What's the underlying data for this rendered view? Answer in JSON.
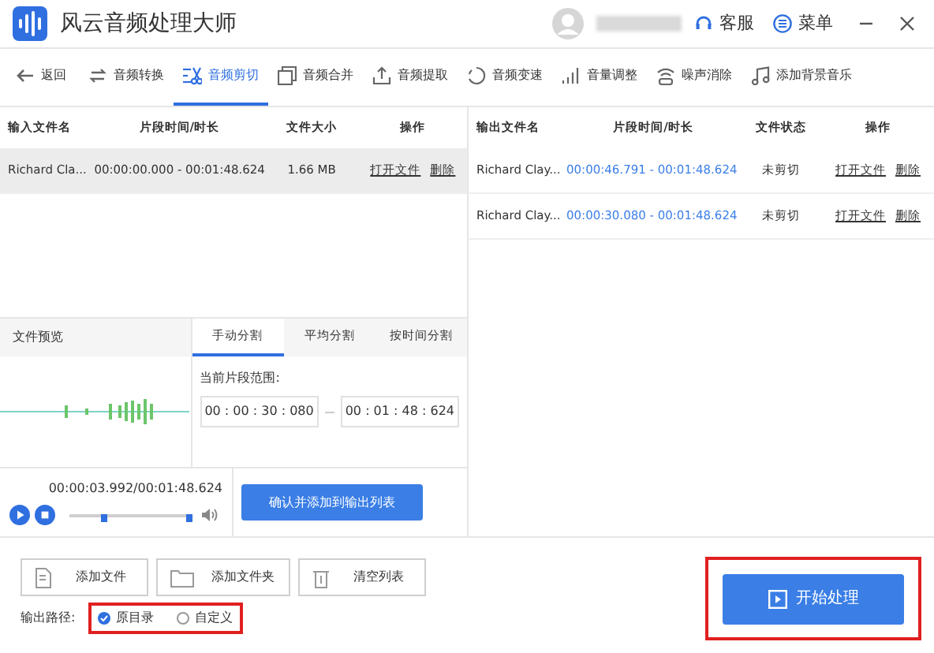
{
  "window": {
    "title": "风云音频处理大师",
    "support": "客服",
    "menu": "菜单"
  },
  "toolbar": [
    {
      "kind": "back",
      "label": "返回",
      "selected": false
    },
    {
      "kind": "convert",
      "label": "音频转换",
      "selected": false
    },
    {
      "kind": "cut",
      "label": "音频剪切",
      "selected": true
    },
    {
      "kind": "merge",
      "label": "音频合并",
      "selected": false
    },
    {
      "kind": "extract",
      "label": "音频提取",
      "selected": false
    },
    {
      "kind": "speed",
      "label": "音频变速",
      "selected": false
    },
    {
      "kind": "volume",
      "label": "音量调整",
      "selected": false
    },
    {
      "kind": "denoise",
      "label": "噪声消除",
      "selected": false
    },
    {
      "kind": "music",
      "label": "添加背景音乐",
      "selected": false
    }
  ],
  "input_table": {
    "columns": [
      "输入文件名",
      "片段时间/时长",
      "文件大小",
      "操作"
    ],
    "rows": [
      {
        "name": "Richard Cla...",
        "range": "00:00:00.000 - 00:01:48.624",
        "size": "1.66 MB",
        "open": "打开文件",
        "delete": "删除",
        "selected": true
      }
    ]
  },
  "output_table": {
    "columns": [
      "输出文件名",
      "片段时间/时长",
      "文件状态",
      "操作"
    ],
    "rows": [
      {
        "name": "Richard Clay...",
        "range": "00:00:46.791 - 00:01:48.624",
        "status": "未剪切",
        "open": "打开文件",
        "delete": "删除"
      },
      {
        "name": "Richard Clay...",
        "range": "00:00:30.080 - 00:01:48.624",
        "status": "未剪切",
        "open": "打开文件",
        "delete": "删除"
      }
    ]
  },
  "preview": {
    "title": "文件预览",
    "time": "00:00:03.992/00:01:48.624",
    "playback": {
      "level": 0.28
    }
  },
  "split_tabs": [
    {
      "label": "手动分割",
      "selected": true
    },
    {
      "label": "平均分割",
      "selected": false
    },
    {
      "label": "按时间分割",
      "selected": false
    }
  ],
  "range": {
    "label": "当前片段范围:",
    "start": "00 : 00 : 30 : 080",
    "end": "00 : 01 : 48 : 624"
  },
  "confirm_button": "确认并添加到输出列表",
  "file_buttons": [
    {
      "kind": "file",
      "label": "添加文件"
    },
    {
      "kind": "folder",
      "label": "添加文件夹"
    },
    {
      "kind": "clear",
      "label": "清空列表"
    }
  ],
  "output_path": {
    "label": "输出路径:",
    "options": [
      {
        "label": "原目录",
        "selected": true
      },
      {
        "label": "自定义",
        "selected": false
      }
    ]
  },
  "start_button": "开始处理"
}
